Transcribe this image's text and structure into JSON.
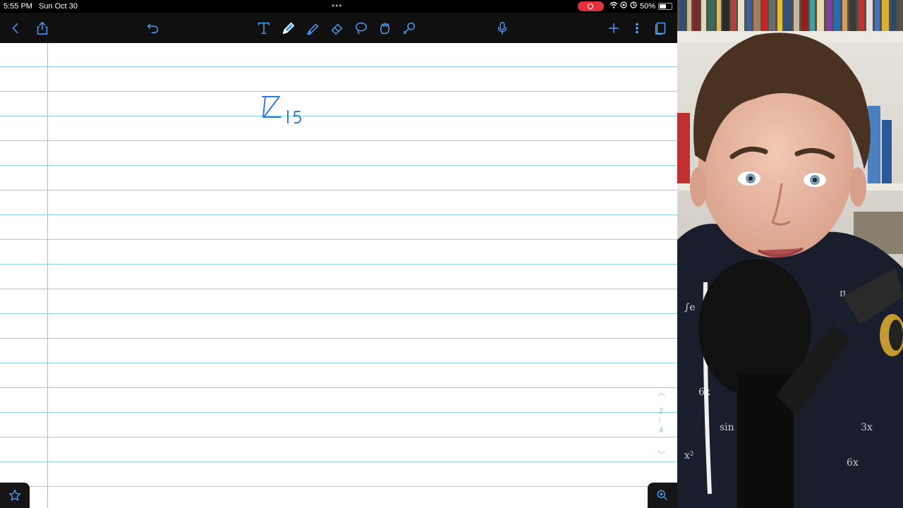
{
  "status_bar": {
    "time": "5:55 PM",
    "date": "Sun Oct 30",
    "battery": "50%"
  },
  "toolbar": {
    "icons": [
      "back-icon",
      "share-icon",
      "undo-icon",
      "text-tool-icon",
      "pen-icon",
      "highlighter-icon",
      "eraser-icon",
      "lasso-icon",
      "shapes-icon",
      "laser-icon",
      "microphone-icon",
      "add-icon",
      "more-icon",
      "pages-icon"
    ],
    "active_tool": "pen"
  },
  "canvas": {
    "ink_color": "#2f7ee6",
    "rule_color": "#8fd0f0",
    "margin_color": "#f0a0a8"
  },
  "pager": {
    "current": "2",
    "total": "4"
  },
  "colors": {
    "accent": "#4a9eff",
    "record": "#e4323d"
  }
}
